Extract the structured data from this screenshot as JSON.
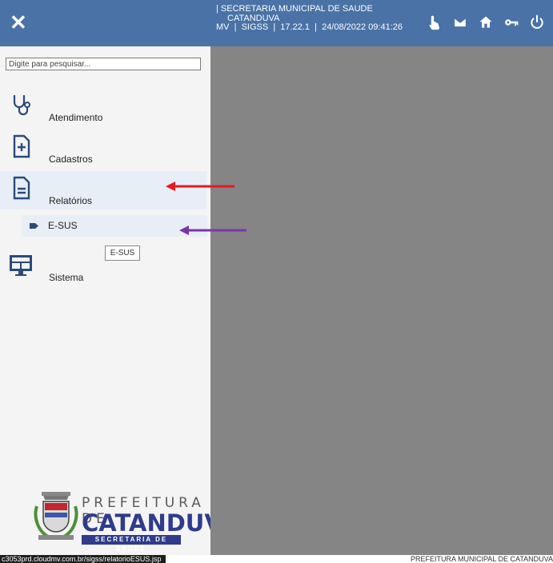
{
  "header": {
    "close_icon": "close-icon",
    "line1": "| SECRETARIA MUNICIPAL DE SAUDE",
    "line2": "CATANDUVA",
    "line3": "MV  |  SIGSS  |  17.22.1  |  24/08/2022 09:41:26",
    "icons": [
      "hand-pointer-icon",
      "mail-icon",
      "home-icon",
      "key-icon",
      "power-icon"
    ],
    "background_color": "#4a72a6"
  },
  "sidebar": {
    "search": {
      "placeholder": "Digite para pesquisar...",
      "value": ""
    },
    "items": [
      {
        "label": "Atendimento",
        "icon": "stethoscope-icon"
      },
      {
        "label": "Cadastros",
        "icon": "file-plus-icon"
      },
      {
        "label": "Relatórios",
        "icon": "document-icon"
      },
      {
        "label": "Sistema",
        "icon": "monitor-icon"
      }
    ],
    "submenu": {
      "label": "E-SUS",
      "icon": "tag-icon"
    },
    "tooltip": "E-SUS",
    "logo": {
      "line1": "PREFEITURA DE",
      "line2": "CATANDUVA",
      "line3": "SECRETARIA DE SAÚDE"
    }
  },
  "annotations": {
    "red_arrow_color": "#e8191d",
    "purple_arrow_color": "#7a35a8"
  },
  "statusbar": {
    "url": "c3053prd.cloudmv.com.br/sigss/relatorioESUS.jsp",
    "right_text": "PREFEITURA MUNICIPAL DE CATANDUVA"
  }
}
